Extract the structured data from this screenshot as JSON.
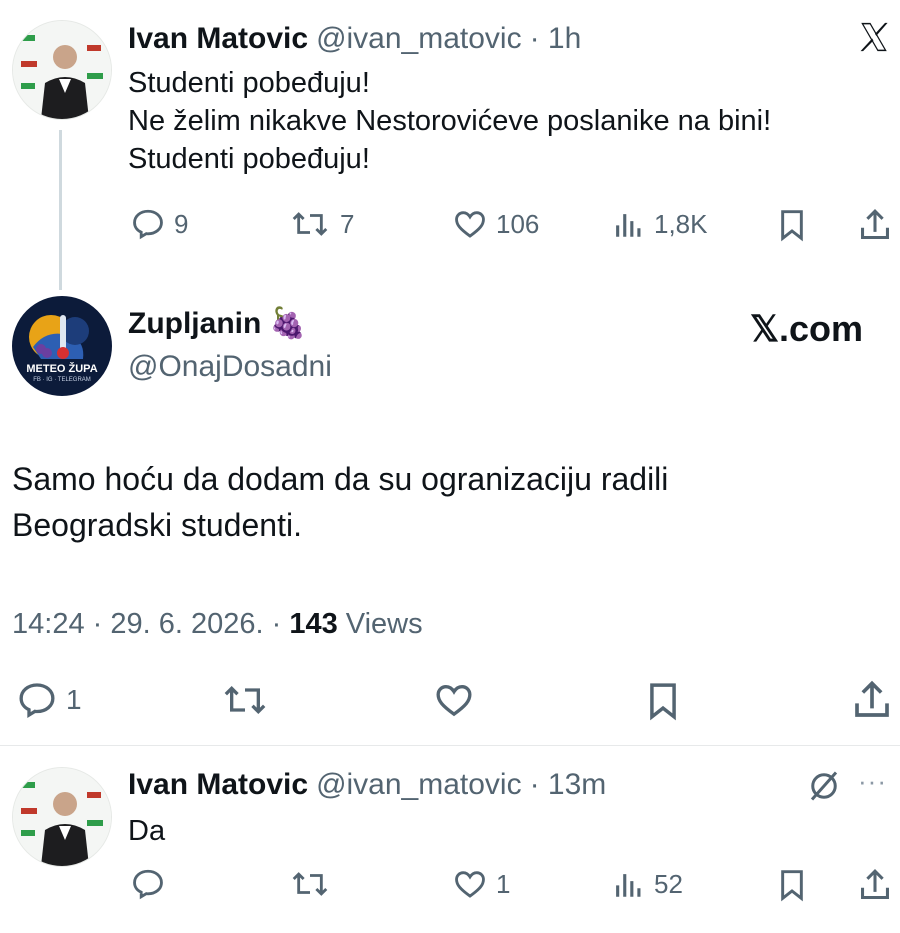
{
  "tweet1": {
    "name": "Ivan Matovic",
    "handle": "@ivan_matovic",
    "time": "· 1h",
    "lines": [
      "Studenti pobeđuju!",
      "Ne želim nikakve Nestorovićeve poslanike na bini!",
      "Studenti pobeđuju!"
    ],
    "replies": "9",
    "retweets": "7",
    "likes": "106",
    "views": "1,8K",
    "icons": [
      "x-logo-icon",
      "reply-icon",
      "retweet-icon",
      "heart-icon",
      "views-icon",
      "bookmark-icon",
      "share-icon"
    ]
  },
  "tweet2": {
    "name": "Zupljanin",
    "emoji": "🍇",
    "handle": "@OnajDosadni",
    "brand": "𝕏.com",
    "avatar_text": "METEO ŽUPA",
    "avatar_subtext": "FB · IG · TELEGRAM",
    "lines": [
      "Samo hoću da dodam da su ogranizaciju radili",
      "Beogradski studenti."
    ],
    "time": "14:24",
    "date": "· 29. 6. 2026. ·",
    "views_count": "143",
    "views_label": "Views",
    "replies": "1"
  },
  "tweet3": {
    "name": "Ivan Matovic",
    "handle": "@ivan_matovic",
    "time": "· 13m",
    "text": "Da",
    "likes": "1",
    "views": "52",
    "more": "···"
  }
}
